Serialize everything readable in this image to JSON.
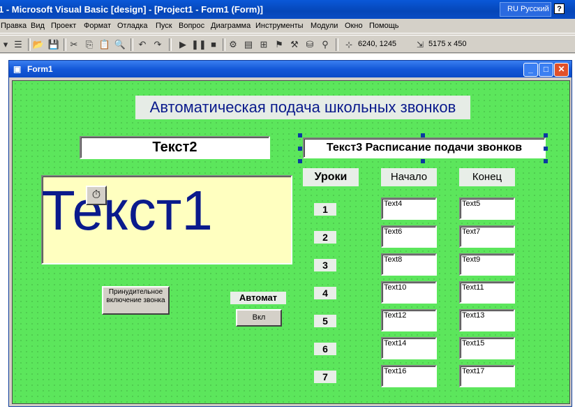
{
  "window": {
    "title": "1 - Microsoft Visual Basic [design] - [Project1 - Form1 (Form)]",
    "language": "RU Русский",
    "help_glyph": "?"
  },
  "menu": [
    "Правка",
    "Вид",
    "Проект",
    "Формат",
    "Отладка",
    "Пуск",
    "Вопрос",
    "Диаграмма",
    "Инструменты",
    "Модули",
    "Окно",
    "Помощь"
  ],
  "toolbar": {
    "position": "6240, 1245",
    "size": "5175 x 450"
  },
  "form": {
    "title": "Form1",
    "heading": "Автоматическая подача школьных звонков",
    "text2": "Текст2",
    "text3": "Текст3 Расписание подачи звонков",
    "text1": "Текст1",
    "lessons_header": "Уроки",
    "start_header": "Начало",
    "end_header": "Конец",
    "lessons": [
      "1",
      "2",
      "3",
      "4",
      "5",
      "6",
      "7"
    ],
    "start_fields": [
      "Text4",
      "Text6",
      "Text8",
      "Text10",
      "Text12",
      "Text14",
      "Text16"
    ],
    "end_fields": [
      "Text5",
      "Text7",
      "Text9",
      "Text11",
      "Text13",
      "Text15",
      "Text17"
    ],
    "force_button": "Принудительное включение звонка",
    "auto_label": "Автомат",
    "on_button": "Вкл"
  },
  "colors": {
    "form_background": "#5ce65c",
    "title_blue": "#0546b8",
    "text1_background": "#ffffc0",
    "text1_color": "#0a1a8c"
  }
}
